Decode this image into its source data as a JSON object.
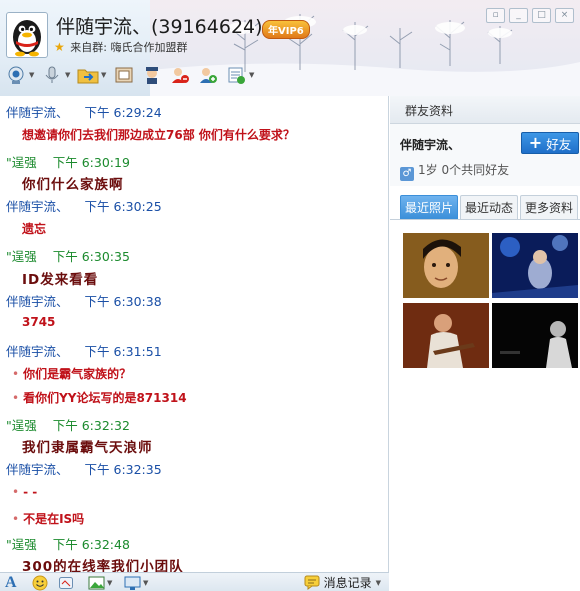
{
  "header": {
    "title": "伴随宇流、(39164624)",
    "vip_badge": "年VIP6",
    "source_prefix": "来自群:",
    "source_group": "嗨氏合作加盟群"
  },
  "toolbar": {
    "icons": [
      "video-call-icon",
      "voice-call-icon",
      "file-transfer-icon",
      "remote-desktop-icon",
      "group-admin-icon",
      "invite-member-icon",
      "add-contact-icon",
      "group-list-icon"
    ]
  },
  "messages": [
    {
      "sender": "伴随宇流、",
      "time": "下午 6:29:24",
      "side": "me",
      "text": "想邀请你们去我们那边成立76部 你们有什么要求？",
      "style": "red",
      "dot": false
    },
    {
      "sender": "\"逞强",
      "time": "下午 6:30:19",
      "side": "other",
      "text": "你们什么家族啊",
      "style": "dark",
      "dot": false
    },
    {
      "sender": "伴随宇流、",
      "time": "下午 6:30:25",
      "side": "me",
      "text": "遗忘",
      "style": "red",
      "dot": false
    },
    {
      "sender": "\"逞强",
      "time": "下午 6:30:35",
      "side": "other",
      "text": "ID发来看看",
      "style": "dark",
      "dot": false
    },
    {
      "sender": "伴随宇流、",
      "time": "下午 6:30:38",
      "side": "me",
      "text": "3745",
      "style": "red",
      "dot": false
    },
    {
      "sender": "伴随宇流、",
      "time": "下午 6:31:51",
      "side": "me",
      "text": "你们是霸气家族的？",
      "style": "red",
      "dot": true
    },
    {
      "sender": "",
      "time": "",
      "side": "me",
      "text": "看你们YY论坛写的是871314",
      "style": "red",
      "dot": true
    },
    {
      "sender": "\"逞强",
      "time": "下午 6:32:32",
      "side": "other",
      "text": "我们隶属霸气天浪师",
      "style": "dark",
      "dot": false
    },
    {
      "sender": "伴随宇流、",
      "time": "下午 6:32:35",
      "side": "me",
      "text": "- -",
      "style": "red",
      "dot": true
    },
    {
      "sender": "",
      "time": "",
      "side": "me",
      "text": "不是在IS吗",
      "style": "red",
      "dot": true
    },
    {
      "sender": "\"逞强",
      "time": "下午 6:32:48",
      "side": "other",
      "text": "300的在线率我们小团队",
      "style": "dark",
      "dot": false
    }
  ],
  "bottom_bar": {
    "history_label": "消息记录"
  },
  "side_panel": {
    "title": "群友资料",
    "member_name": "伴随宇流、",
    "add_friend_label": "好友",
    "member_meta": "1岁  0个共同好友",
    "tabs": [
      "最近照片",
      "最近动态",
      "更多资料"
    ],
    "active_tab": 0
  },
  "colors": {
    "sender_me": "#1a4fa6",
    "sender_other": "#1b8a2d",
    "message_red": "#c0121a",
    "message_dark": "#6b0d0d",
    "accent_blue": "#1f6fc9"
  }
}
